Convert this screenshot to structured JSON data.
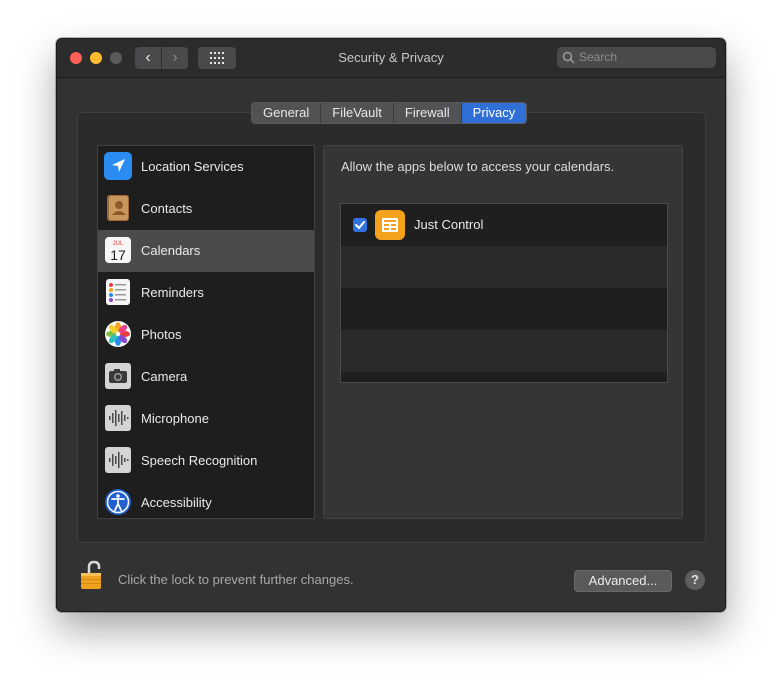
{
  "window": {
    "title": "Security & Privacy",
    "search_placeholder": "Search",
    "back_glyph": "‹",
    "forward_glyph": "›"
  },
  "tabs": [
    {
      "label": "General",
      "active": false
    },
    {
      "label": "FileVault",
      "active": false
    },
    {
      "label": "Firewall",
      "active": false
    },
    {
      "label": "Privacy",
      "active": true
    }
  ],
  "sidebar": {
    "items": [
      {
        "label": "Location Services",
        "icon": "location-arrow-icon",
        "selected": false
      },
      {
        "label": "Contacts",
        "icon": "contacts-book-icon",
        "selected": false
      },
      {
        "label": "Calendars",
        "icon": "calendar-icon",
        "selected": true
      },
      {
        "label": "Reminders",
        "icon": "reminders-list-icon",
        "selected": false
      },
      {
        "label": "Photos",
        "icon": "photos-flower-icon",
        "selected": false
      },
      {
        "label": "Camera",
        "icon": "camera-icon",
        "selected": false
      },
      {
        "label": "Microphone",
        "icon": "waveform-icon",
        "selected": false
      },
      {
        "label": "Speech Recognition",
        "icon": "waveform-icon",
        "selected": false
      },
      {
        "label": "Accessibility",
        "icon": "accessibility-icon",
        "selected": false
      }
    ],
    "calendar_icon_text": {
      "month": "JUL",
      "day": "17"
    }
  },
  "content": {
    "description": "Allow the apps below to access your calendars.",
    "apps": [
      {
        "name": "Just Control",
        "checked": true,
        "icon": "just-control-app-icon"
      }
    ]
  },
  "footer": {
    "lock_text": "Click the lock to prevent further changes.",
    "advanced_label": "Advanced...",
    "help_label": "?"
  },
  "colors": {
    "accent": "#2f6fd6",
    "window_bg": "#323233",
    "close": "#fe5f57",
    "minimize": "#febc2e",
    "app_icon": "#f4a21c"
  }
}
